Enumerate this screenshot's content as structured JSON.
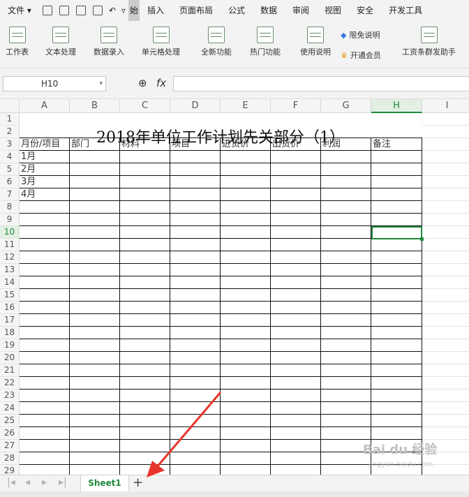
{
  "menubar": {
    "file": "文件",
    "start": "始",
    "items": [
      "插入",
      "页面布局",
      "公式",
      "数据",
      "审阅",
      "视图",
      "安全",
      "开发工具"
    ]
  },
  "ribbon": {
    "buttons": [
      "工作表",
      "文本处理",
      "数据录入",
      "单元格处理",
      "全新功能",
      "热门功能",
      "使用说明"
    ],
    "limited_free": "限免说明",
    "open_member": "开通会员",
    "payroll": "工资条群发助手"
  },
  "formula_bar": {
    "cell_ref": "H10",
    "fx": "fx"
  },
  "grid": {
    "columns": [
      "A",
      "B",
      "C",
      "D",
      "E",
      "F",
      "G",
      "H",
      "I"
    ],
    "active_column": "H",
    "active_row": 10,
    "rows": [
      "1",
      "2",
      "3",
      "4",
      "5",
      "6",
      "7",
      "8",
      "9",
      "10",
      "11",
      "12",
      "13",
      "14",
      "15",
      "16",
      "17",
      "18",
      "19",
      "20",
      "21",
      "22",
      "23",
      "24",
      "25",
      "26",
      "27",
      "28",
      "29"
    ],
    "title": "2018年单位工作计划先关部分（1）",
    "header_row": [
      "月份/项目",
      "部门",
      "材料",
      "项目",
      "进货价",
      "出货价",
      "利润",
      "备注"
    ],
    "months": [
      "1月",
      "2月",
      "3月",
      "4月"
    ]
  },
  "sheet_tabs": {
    "active": "Sheet1",
    "add": "+"
  },
  "watermark": {
    "brand": "Bai du 经验",
    "url": "jingyan.baidu.com"
  },
  "colors": {
    "accent": "#1e8a3c",
    "arrow": "#e8352b"
  }
}
